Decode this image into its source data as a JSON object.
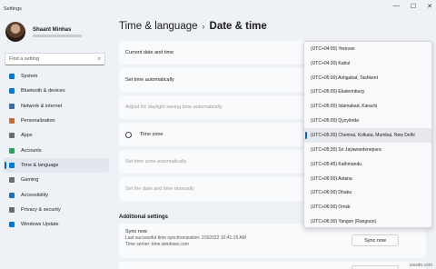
{
  "window": {
    "title": "Settings",
    "controls": [
      "—",
      "☐",
      "✕"
    ]
  },
  "profile": {
    "name": "Shaant Minhas"
  },
  "search": {
    "placeholder": "Find a setting"
  },
  "sidebar": {
    "items": [
      {
        "label": "System",
        "icon": "monitor-icon",
        "color": "#0078d4",
        "active": false
      },
      {
        "label": "Bluetooth & devices",
        "icon": "bluetooth-icon",
        "color": "#0078d4",
        "active": false
      },
      {
        "label": "Network & internet",
        "icon": "wifi-icon",
        "color": "#3a6ea5",
        "active": false
      },
      {
        "label": "Personalization",
        "icon": "brush-icon",
        "color": "#c76a3a",
        "active": false
      },
      {
        "label": "Apps",
        "icon": "apps-icon",
        "color": "#6b6b6b",
        "active": false
      },
      {
        "label": "Accounts",
        "icon": "person-icon",
        "color": "#2e9e5b",
        "active": false
      },
      {
        "label": "Time & language",
        "icon": "globe-clock-icon",
        "color": "#0078d4",
        "active": true
      },
      {
        "label": "Gaming",
        "icon": "gamepad-icon",
        "color": "#6b6b6b",
        "active": false
      },
      {
        "label": "Accessibility",
        "icon": "accessibility-icon",
        "color": "#1f6fbf",
        "active": false
      },
      {
        "label": "Privacy & security",
        "icon": "shield-icon",
        "color": "#6b6b6b",
        "active": false
      },
      {
        "label": "Windows Update",
        "icon": "update-icon",
        "color": "#0078d4",
        "active": false
      }
    ]
  },
  "breadcrumb": {
    "parent": "Time & language",
    "separator": "›",
    "current": "Date & time"
  },
  "rows": {
    "current": "Current date and time",
    "auto_time": "Set time automatically",
    "dst": "Adjust for daylight saving time automatically",
    "timezone": "Time zone",
    "auto_zone": "Set time zone automatically",
    "manual": "Set the date and time manually"
  },
  "additional": {
    "title": "Additional settings",
    "sync_title": "Sync now",
    "sync_last": "Last successful time synchronization: 2/3/2022 10:41:15 AM",
    "sync_server": "Time server: time.windows.com",
    "sync_button": "Sync now"
  },
  "timezones": {
    "options": [
      "(UTC+04:00) Yerevan",
      "(UTC+04:30) Kabul",
      "(UTC+05:00) Ashgabat, Tashkent",
      "(UTC+05:00) Ekaterinburg",
      "(UTC+05:00) Islamabad, Karachi",
      "(UTC+05:00) Qyzylorda",
      "(UTC+05:30) Chennai, Kolkata, Mumbai, New Delhi",
      "(UTC+05:30) Sri Jayawardenepura",
      "(UTC+05:45) Kathmandu",
      "(UTC+06:00) Astana",
      "(UTC+06:00) Dhaka",
      "(UTC+06:00) Omsk",
      "(UTC+06:30) Yangon (Rangoon)"
    ],
    "selected": "(UTC+05:30) Chennai, Kolkata, Mumbai, New Delhi"
  },
  "watermark": "wsxdn.com",
  "colors": {
    "accent": "#0067c0",
    "background": "#eef1f6",
    "card": "#f9fafc"
  }
}
